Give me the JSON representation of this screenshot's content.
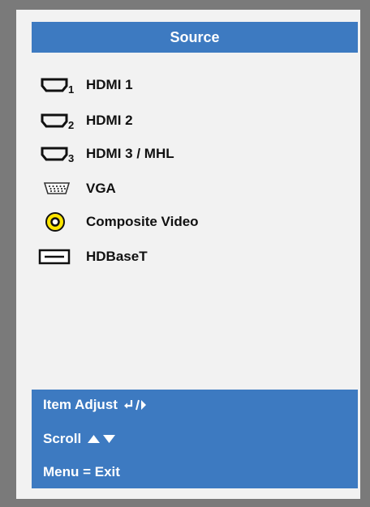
{
  "window": {
    "title": "Source"
  },
  "sources": [
    {
      "label": "HDMI 1",
      "icon": "hdmi-1-icon"
    },
    {
      "label": "HDMI 2",
      "icon": "hdmi-2-icon"
    },
    {
      "label": "HDMI 3 / MHL",
      "icon": "hdmi-3-icon"
    },
    {
      "label": "VGA",
      "icon": "vga-icon"
    },
    {
      "label": "Composite Video",
      "icon": "composite-video-icon"
    },
    {
      "label": "HDBaseT",
      "icon": "hdbaset-icon"
    }
  ],
  "icon_digits": {
    "hdmi_1": "1",
    "hdmi_2": "2",
    "hdmi_3": "3"
  },
  "help": {
    "item_adjust": "Item Adjust",
    "scroll": "Scroll",
    "menu_exit": "Menu = Exit"
  },
  "colors": {
    "accent": "#3d7ac1",
    "composite_yellow": "#ffe600"
  }
}
